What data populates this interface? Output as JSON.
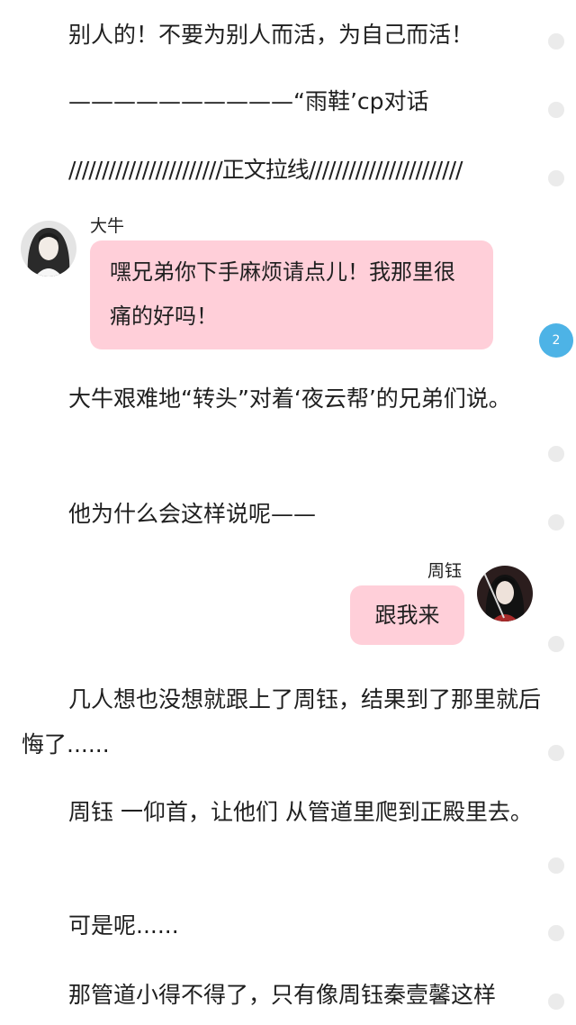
{
  "story": {
    "p0": "别人的！不要为别人而活，为自己而活！",
    "p1": "——————————“雨鞋’cp对话",
    "p2": "///////////////////////正文拉线///////////////////////",
    "p3": "大牛艰难地“转头”对着‘夜云帮’的兄弟们说。",
    "p4": "他为什么会这样说呢——",
    "p5": "几人想也没想就跟上了周钰，结果到了那里就后悔了......",
    "p6": "周钰 一仰首，让他们 从管道里爬到正殿里去。",
    "p7": "可是呢......",
    "p8": "那管道小得不得了，只有像周钰秦壹馨这样"
  },
  "chat": [
    {
      "speaker": "大牛",
      "text": "嘿兄弟你下手麻烦请点儿！我那里很痛的好吗！",
      "side": "left"
    },
    {
      "speaker": "周钰",
      "text": "跟我来",
      "side": "right"
    }
  ],
  "side_badge": {
    "count": "2"
  },
  "colors": {
    "bubble": "#ffcfd9",
    "badge": "#4db3e6",
    "dot": "#ebebeb"
  }
}
